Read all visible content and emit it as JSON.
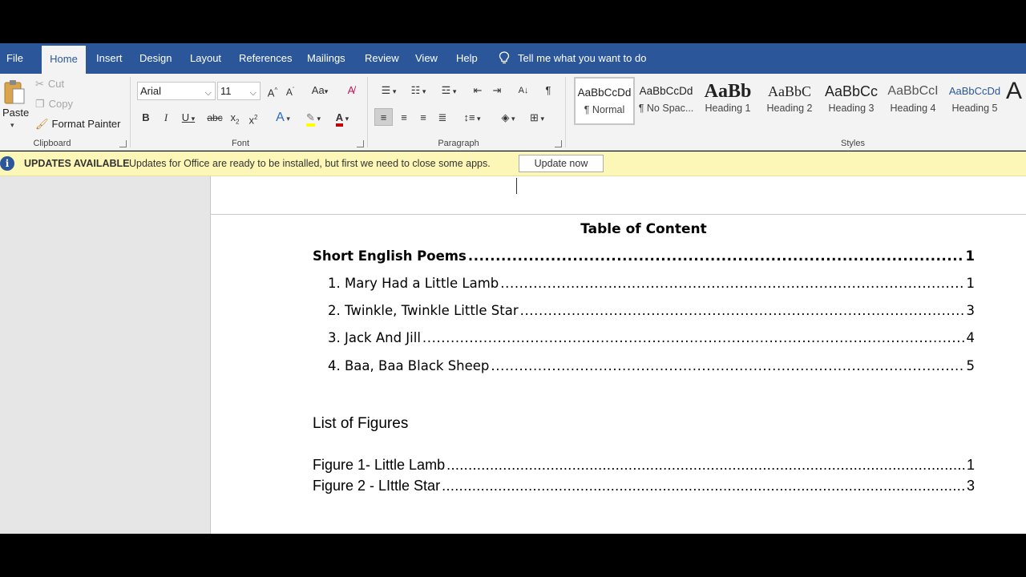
{
  "tabs": [
    "File",
    "Home",
    "Insert",
    "Design",
    "Layout",
    "References",
    "Mailings",
    "Review",
    "View",
    "Help"
  ],
  "active_tab": "Home",
  "tell_me": "Tell me what you want to do",
  "clipboard": {
    "paste": "Paste",
    "cut": "Cut",
    "copy": "Copy",
    "format_painter": "Format Painter",
    "label": "Clipboard"
  },
  "font": {
    "name": "Arial",
    "size": "11",
    "label": "Font"
  },
  "paragraph": {
    "label": "Paragraph"
  },
  "styles": {
    "label": "Styles",
    "items": [
      {
        "sample": "AaBbCcDd",
        "name": "¶ Normal"
      },
      {
        "sample": "AaBbCcDd",
        "name": "¶ No Spac..."
      },
      {
        "sample": "AaBb",
        "name": "Heading 1"
      },
      {
        "sample": "AaBbC",
        "name": "Heading 2"
      },
      {
        "sample": "AaBbCc",
        "name": "Heading 3"
      },
      {
        "sample": "AaBbCcI",
        "name": "Heading 4"
      },
      {
        "sample": "AaBbCcDd",
        "name": "Heading 5"
      },
      {
        "sample": "A",
        "name": ""
      }
    ]
  },
  "update_bar": {
    "title": "UPDATES AVAILABLE",
    "message": "Updates for Office are ready to be installed, but first we need to close some apps.",
    "button": "Update now"
  },
  "document": {
    "toc_title": "Table of Content",
    "toc_entries": [
      {
        "text": "Short English Poems",
        "page": "1",
        "bold": true
      },
      {
        "text": "1. Mary Had a Little Lamb",
        "page": "1",
        "bold": false
      },
      {
        "text": "2. Twinkle, Twinkle Little Star",
        "page": "3",
        "bold": false
      },
      {
        "text": "3. Jack And Jill",
        "page": "4",
        "bold": false
      },
      {
        "text": "4. Baa, Baa Black Sheep",
        "page": "5",
        "bold": false
      }
    ],
    "figures_heading": "List of Figures",
    "figures": [
      {
        "text": "Figure 1- Little Lamb",
        "page": "1"
      },
      {
        "text": "Figure 2 - LIttle Star",
        "page": "3"
      }
    ]
  },
  "colors": {
    "accent": "#2b579a",
    "ribbon_bg": "#f3f3f3",
    "update_bar_bg": "#fcf7b6",
    "font_color_underline": "#c00000",
    "highlight_underline": "#ffff00"
  }
}
